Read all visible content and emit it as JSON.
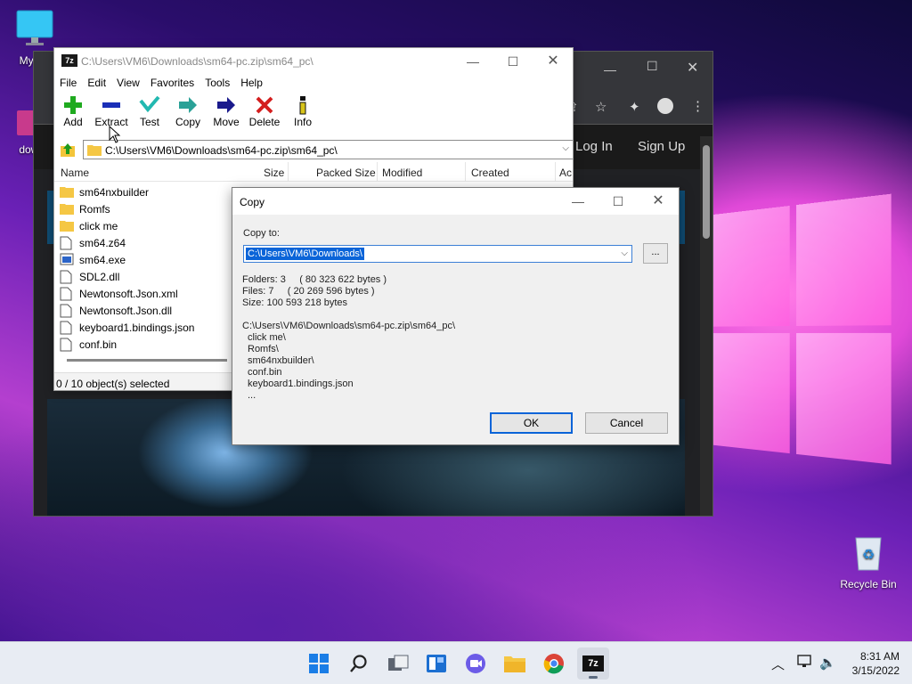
{
  "desktop": {
    "icons": [
      {
        "label": "My Co",
        "icon": "computer-icon"
      },
      {
        "label": "downl",
        "icon": "folder-icon"
      },
      {
        "label": "Recycle Bin",
        "icon": "recycle-bin-icon"
      }
    ]
  },
  "browser": {
    "nav": {
      "login": "Log In",
      "signup": "Sign Up"
    }
  },
  "zip_window": {
    "title": "C:\\Users\\VM6\\Downloads\\sm64-pc.zip\\sm64_pc\\",
    "app_badge": "7z",
    "menu": [
      "File",
      "Edit",
      "View",
      "Favorites",
      "Tools",
      "Help"
    ],
    "toolbar": [
      "Add",
      "Extract",
      "Test",
      "Copy",
      "Move",
      "Delete",
      "Info"
    ],
    "path": "C:\\Users\\VM6\\Downloads\\sm64-pc.zip\\sm64_pc\\",
    "columns": [
      "Name",
      "Size",
      "Packed Size",
      "Modified",
      "Created",
      "Ac"
    ],
    "files": [
      {
        "name": "sm64nxbuilder",
        "type": "folder"
      },
      {
        "name": "Romfs",
        "type": "folder"
      },
      {
        "name": "click me",
        "type": "folder"
      },
      {
        "name": "sm64.z64",
        "type": "file"
      },
      {
        "name": "sm64.exe",
        "type": "exe"
      },
      {
        "name": "SDL2.dll",
        "type": "file"
      },
      {
        "name": "Newtonsoft.Json.xml",
        "type": "file"
      },
      {
        "name": "Newtonsoft.Json.dll",
        "type": "file"
      },
      {
        "name": "keyboard1.bindings.json",
        "type": "file"
      },
      {
        "name": "conf.bin",
        "type": "file"
      }
    ],
    "status": "0 / 10 object(s) selected"
  },
  "copy_dialog": {
    "title": "Copy",
    "copy_to_label": "Copy to:",
    "destination": "C:\\Users\\VM6\\Downloads\\",
    "browse_label": "...",
    "folders_line": "Folders: 3     ( 80 323 622 bytes )",
    "files_line": "Files: 7     ( 20 269 596 bytes )",
    "size_line": "Size: 100 593 218 bytes",
    "source_path": "C:\\Users\\VM6\\Downloads\\sm64-pc.zip\\sm64_pc\\",
    "items": [
      "click me\\",
      "Romfs\\",
      "sm64nxbuilder\\",
      "conf.bin",
      "keyboard1.bindings.json",
      "..."
    ],
    "ok_label": "OK",
    "cancel_label": "Cancel"
  },
  "taskbar": {
    "apps": [
      "start",
      "search",
      "task-view",
      "widgets",
      "chat",
      "file-explorer",
      "chrome",
      "7zip"
    ],
    "active_app": "7zip",
    "time": "8:31 AM",
    "date": "3/15/2022"
  }
}
